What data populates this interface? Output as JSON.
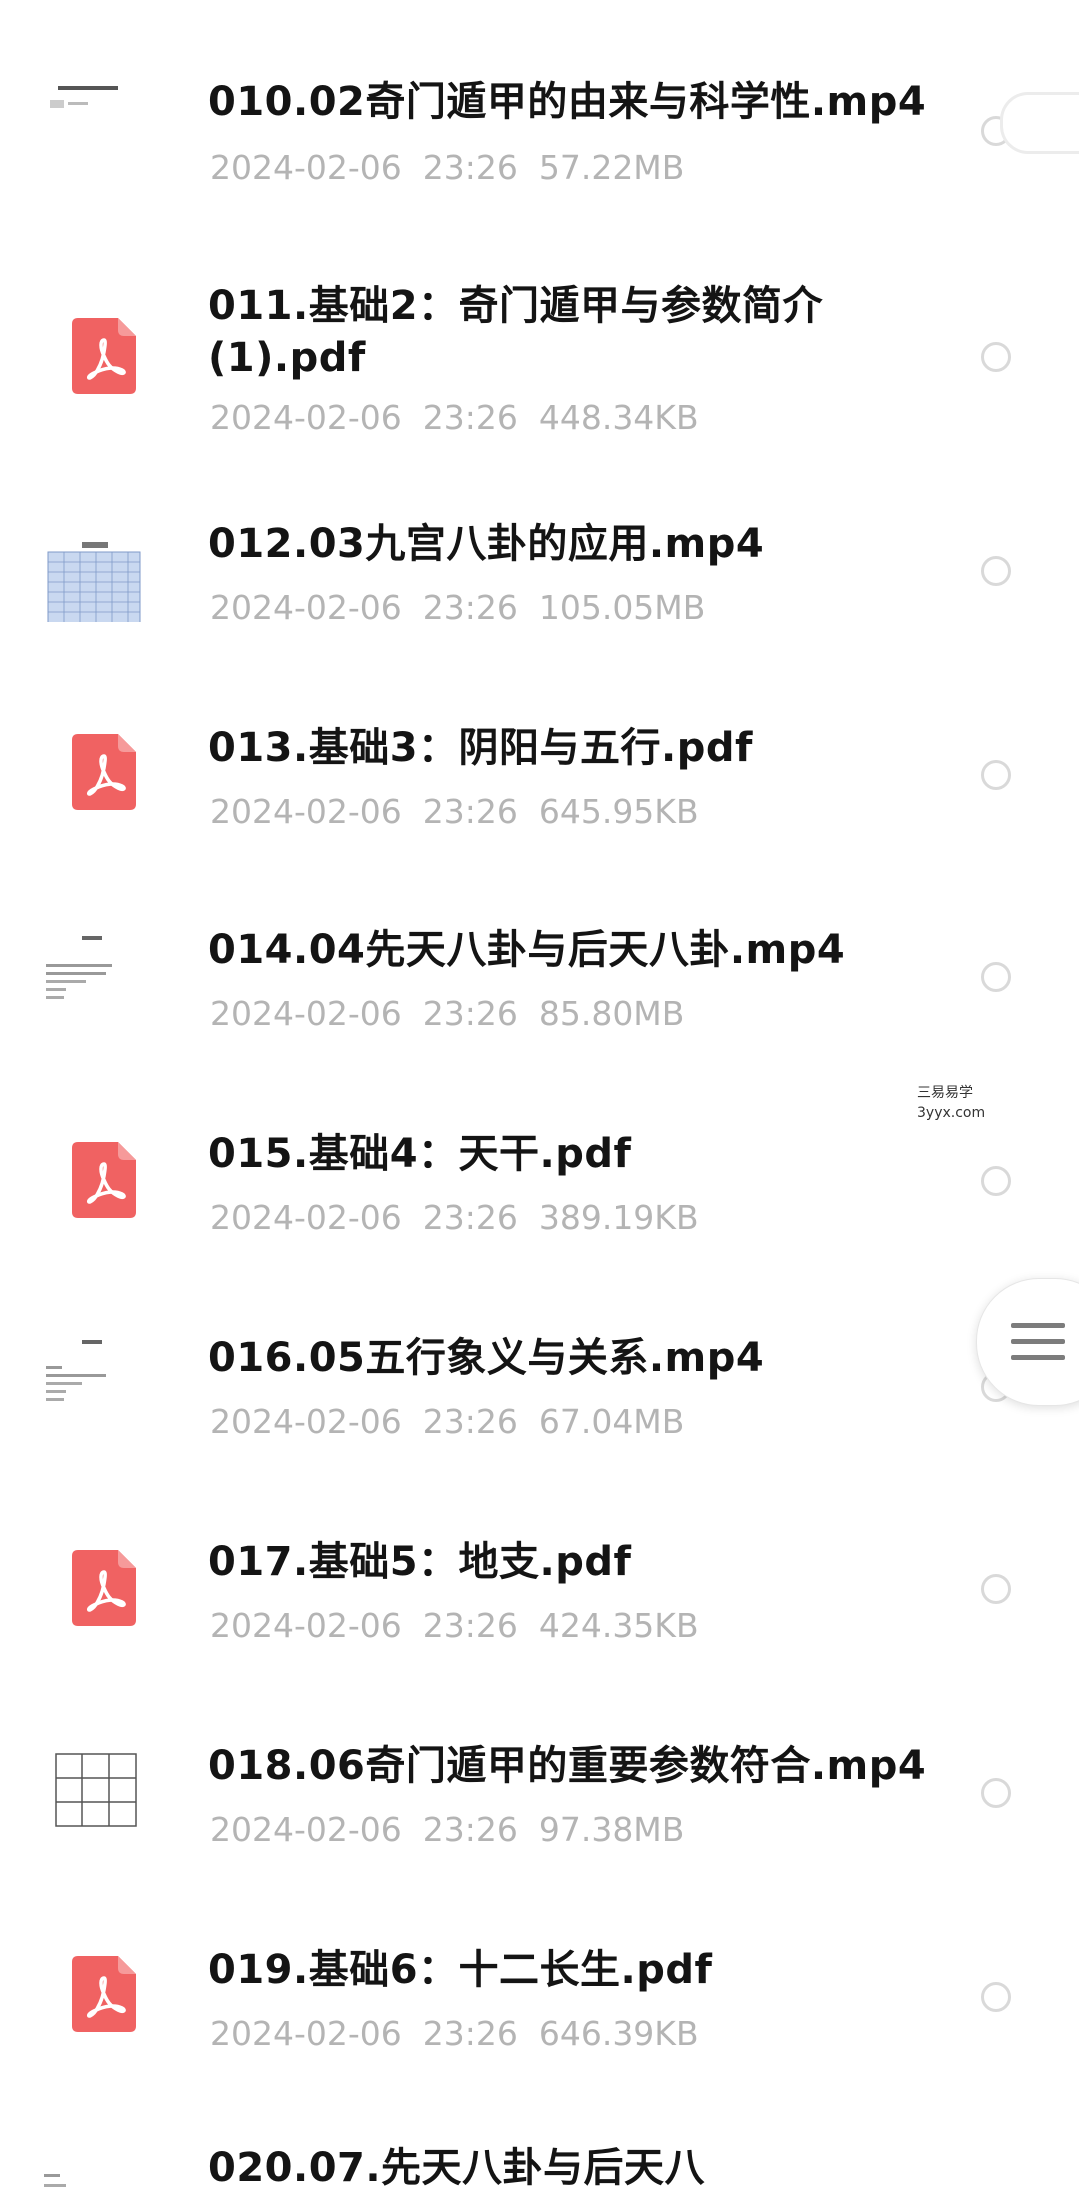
{
  "files": [
    {
      "title": "010.02奇门遁甲的由来与科学性.mp4",
      "meta": "2024-02-06  23:26  57.22MB",
      "kind": "video"
    },
    {
      "title": "011.基础2：奇门遁甲与参数简介(1).pdf",
      "meta": "2024-02-06  23:26  448.34KB",
      "kind": "pdf"
    },
    {
      "title": "012.03九宫八卦的应用.mp4",
      "meta": "2024-02-06  23:26  105.05MB",
      "kind": "video"
    },
    {
      "title": "013.基础3：阴阳与五行.pdf",
      "meta": "2024-02-06  23:26  645.95KB",
      "kind": "pdf"
    },
    {
      "title": "014.04先天八卦与后天八卦.mp4",
      "meta": "2024-02-06  23:26  85.80MB",
      "kind": "video"
    },
    {
      "title": "015.基础4：天干.pdf",
      "meta": "2024-02-06  23:26  389.19KB",
      "kind": "pdf"
    },
    {
      "title": "016.05五行象义与关系.mp4",
      "meta": "2024-02-06  23:26  67.04MB",
      "kind": "video"
    },
    {
      "title": "017.基础5：地支.pdf",
      "meta": "2024-02-06  23:26  424.35KB",
      "kind": "pdf"
    },
    {
      "title": "018.06奇门遁甲的重要参数符合.mp4",
      "meta": "2024-02-06  23:26  97.38MB",
      "kind": "video"
    },
    {
      "title": "019.基础6：十二长生.pdf",
      "meta": "2024-02-06  23:26  646.39KB",
      "kind": "pdf"
    },
    {
      "title": "020.07.先天八卦与后天八",
      "meta": "",
      "kind": "video"
    }
  ],
  "watermark": {
    "line1": "三易易学",
    "line2": "3yyx.com"
  },
  "colors": {
    "pdf_red": "#f06262",
    "title": "#141414",
    "meta": "#b4b4b4"
  },
  "icons": {
    "pdf": "pdf-icon",
    "video": "video-thumbnail",
    "radio": "radio-circle",
    "menu": "hamburger-menu-icon"
  }
}
